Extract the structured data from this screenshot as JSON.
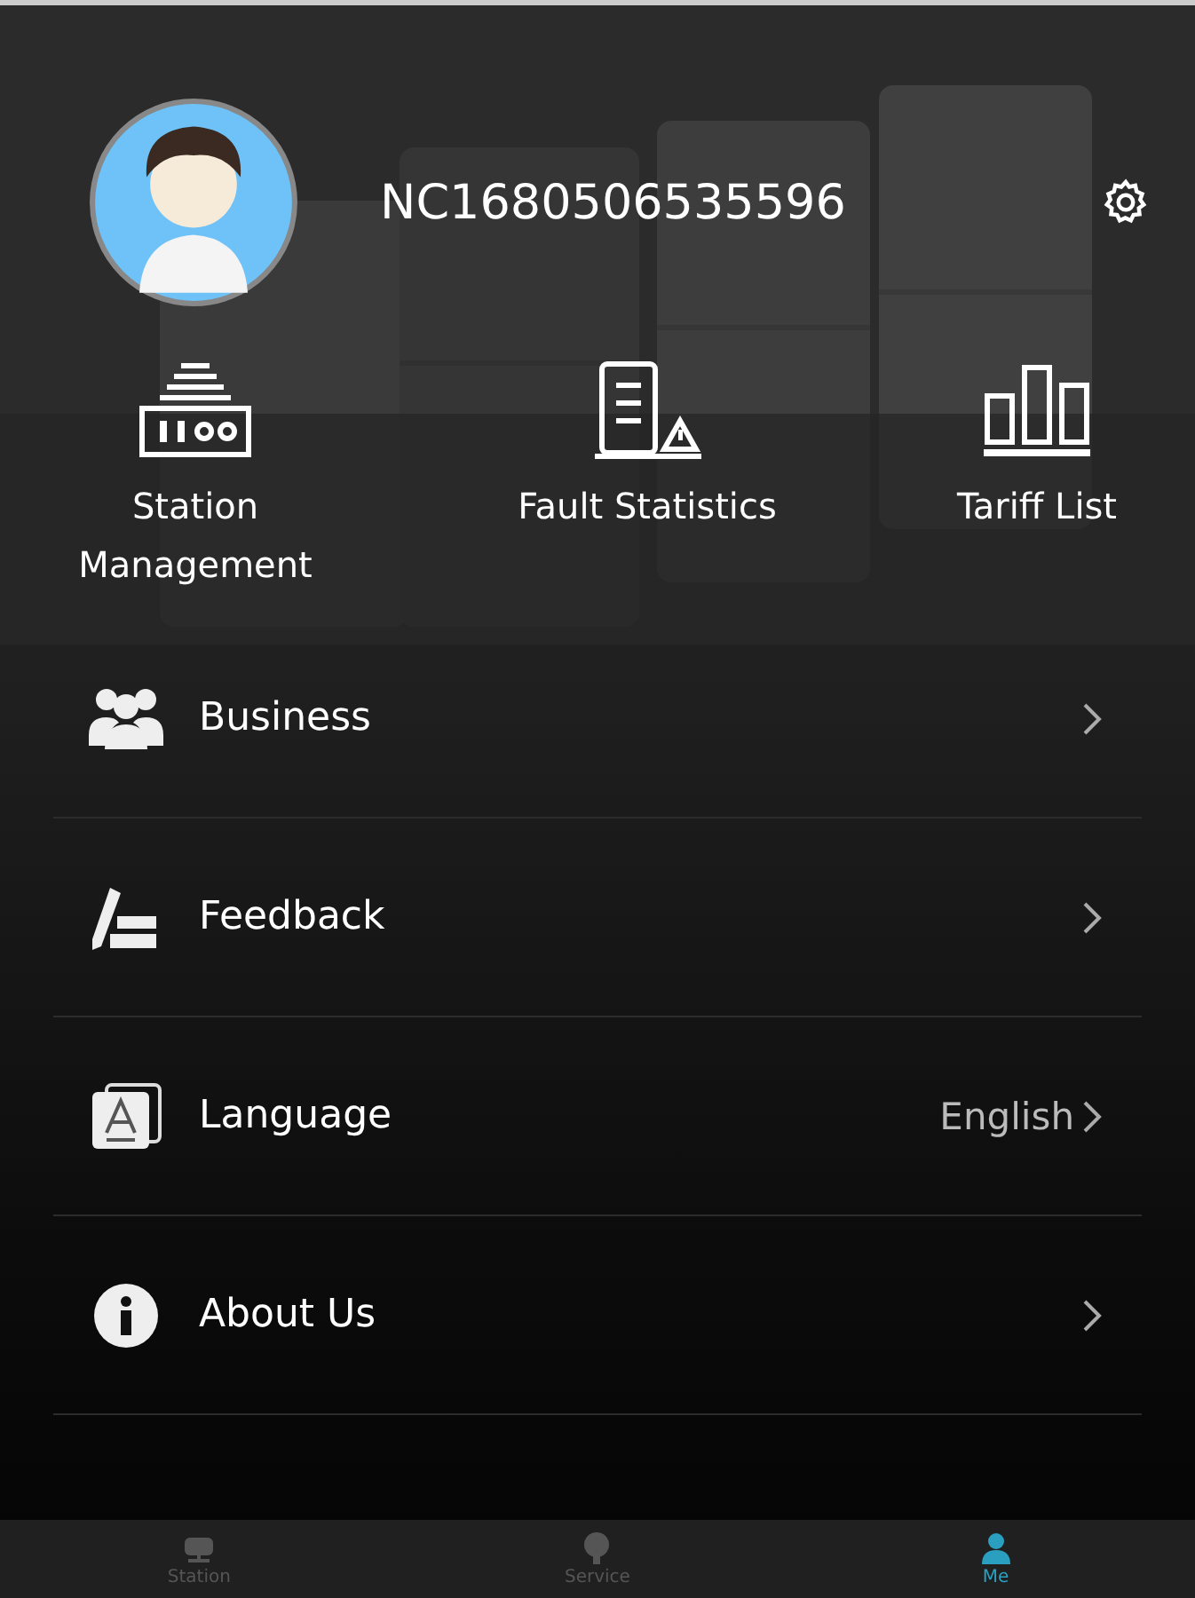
{
  "profile": {
    "username": "NC1680506535596"
  },
  "quick_actions": [
    {
      "label": "Station Management"
    },
    {
      "label": "Fault Statistics"
    },
    {
      "label": "Tariff List"
    }
  ],
  "menu": [
    {
      "label": "Business"
    },
    {
      "label": "Feedback"
    },
    {
      "label": "Language",
      "value": "English"
    },
    {
      "label": "About Us"
    }
  ],
  "bottom_nav": [
    {
      "label": "Station",
      "selected": false
    },
    {
      "label": "Service",
      "selected": false
    },
    {
      "label": "Me",
      "selected": true
    }
  ]
}
